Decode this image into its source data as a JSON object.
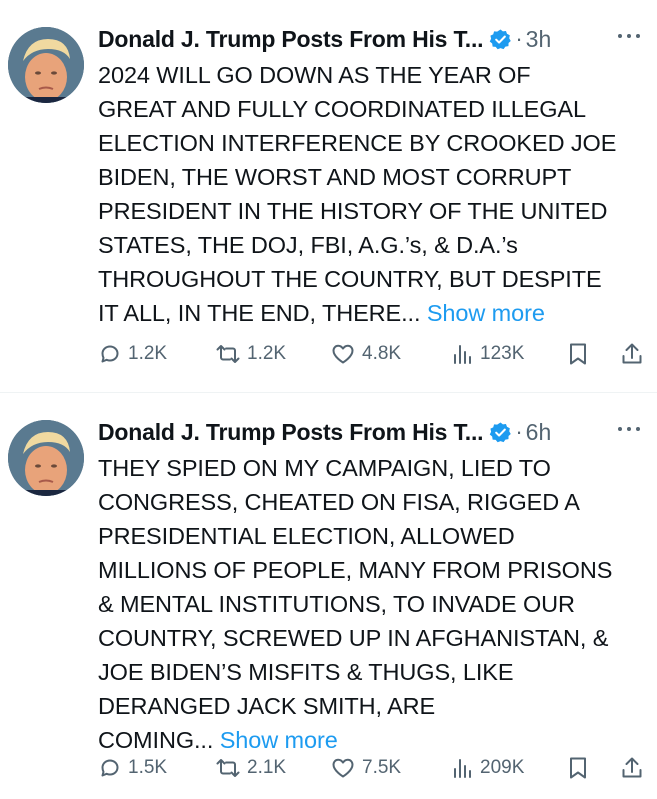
{
  "posts": [
    {
      "author": "Donald J. Trump Posts From His T...",
      "separator": "·",
      "time": "3h",
      "lines": [
        "2024 WILL GO DOWN AS THE YEAR OF",
        "GREAT AND FULLY COORDINATED ILLEGAL",
        "ELECTION INTERFERENCE BY CROOKED JOE",
        "BIDEN, THE WORST AND MOST CORRUPT",
        "PRESIDENT IN THE HISTORY OF THE UNITED",
        "STATES, THE DOJ, FBI, A.G.’s, & D.A.’s",
        "THROUGHOUT THE COUNTRY, BUT DESPITE"
      ],
      "last_line": "IT ALL, IN THE END, THERE...",
      "show_more": "Show more",
      "replies": "1.2K",
      "reposts": "1.2K",
      "likes": "4.8K",
      "views": "123K"
    },
    {
      "author": "Donald J. Trump Posts From His T...",
      "separator": "·",
      "time": "6h",
      "lines": [
        "THEY SPIED ON MY CAMPAIGN, LIED TO",
        "CONGRESS, CHEATED ON FISA, RIGGED A",
        "PRESIDENTIAL ELECTION, ALLOWED",
        "MILLIONS OF PEOPLE, MANY FROM PRISONS",
        "& MENTAL INSTITUTIONS, TO INVADE OUR",
        "COUNTRY, SCREWED UP IN AFGHANISTAN, &",
        "JOE BIDEN’S MISFITS & THUGS, LIKE",
        "DERANGED JACK SMITH, ARE"
      ],
      "last_line": "COMING...",
      "show_more": "Show more",
      "replies": "1.5K",
      "reposts": "2.1K",
      "likes": "7.5K",
      "views": "209K"
    }
  ],
  "icons": {
    "reply": "reply-icon",
    "repost": "repost-icon",
    "like": "like-icon",
    "views": "views-icon",
    "bookmark": "bookmark-icon",
    "share": "share-icon",
    "verified": "verified-badge-icon",
    "more": "more-options-icon"
  },
  "colors": {
    "text": "#0f1419",
    "secondary": "#536471",
    "link": "#1d9bf0",
    "verified": "#1d9bf0"
  }
}
